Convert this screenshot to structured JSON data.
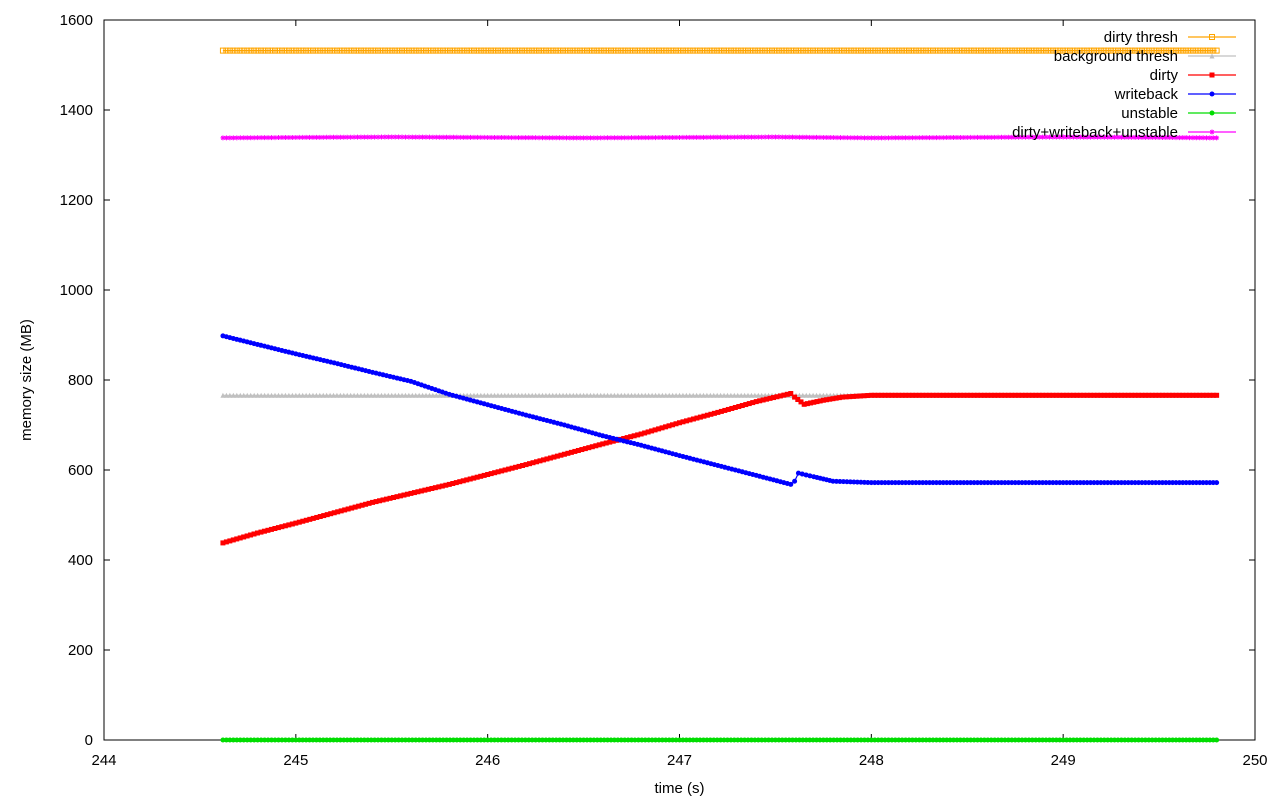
{
  "chart_data": {
    "type": "line",
    "xlabel": "time (s)",
    "ylabel": "memory size (MB)",
    "xlim": [
      244,
      250
    ],
    "ylim": [
      0,
      1600
    ],
    "xticks": [
      244,
      245,
      246,
      247,
      248,
      249,
      250
    ],
    "yticks": [
      0,
      200,
      400,
      600,
      800,
      1000,
      1200,
      1400,
      1600
    ],
    "grid": false,
    "legend_position": "top-right",
    "series": [
      {
        "name": "dirty thresh",
        "color": "#ffa500",
        "marker": "square-open",
        "x": [
          244.62,
          245.0,
          245.5,
          246.0,
          246.5,
          247.0,
          247.5,
          248.0,
          248.5,
          249.0,
          249.5,
          249.8
        ],
        "y": [
          1532,
          1532,
          1532,
          1532,
          1532,
          1532,
          1532,
          1532,
          1532,
          1532,
          1532,
          1532
        ]
      },
      {
        "name": "background thresh",
        "color": "#c0c0c0",
        "marker": "triangle",
        "x": [
          244.62,
          245.0,
          245.5,
          246.0,
          246.5,
          247.0,
          247.5,
          248.0,
          248.5,
          249.0,
          249.5,
          249.8
        ],
        "y": [
          766,
          766,
          766,
          766,
          766,
          766,
          766,
          766,
          766,
          766,
          766,
          766
        ]
      },
      {
        "name": "dirty",
        "color": "#ff0000",
        "marker": "square",
        "x": [
          244.62,
          244.8,
          245.0,
          245.2,
          245.4,
          245.6,
          245.8,
          246.0,
          246.2,
          246.4,
          246.6,
          246.8,
          247.0,
          247.2,
          247.4,
          247.58,
          247.6,
          247.65,
          247.75,
          247.85,
          248.0,
          248.5,
          249.0,
          249.5,
          249.8
        ],
        "y": [
          438,
          460,
          482,
          505,
          528,
          548,
          568,
          590,
          612,
          635,
          658,
          680,
          705,
          728,
          752,
          770,
          762,
          746,
          755,
          762,
          766,
          766,
          766,
          766,
          766
        ]
      },
      {
        "name": "writeback",
        "color": "#0000ff",
        "marker": "circle",
        "x": [
          244.62,
          244.8,
          245.0,
          245.2,
          245.4,
          245.6,
          245.8,
          246.0,
          246.2,
          246.4,
          246.6,
          246.8,
          247.0,
          247.2,
          247.4,
          247.58,
          247.6,
          247.62,
          247.7,
          247.8,
          248.0,
          248.5,
          249.0,
          249.5,
          249.8
        ],
        "y": [
          898,
          879,
          858,
          838,
          817,
          797,
          768,
          745,
          722,
          700,
          676,
          655,
          632,
          610,
          588,
          568,
          575,
          593,
          585,
          575,
          572,
          572,
          572,
          572,
          572
        ]
      },
      {
        "name": "unstable",
        "color": "#00dd00",
        "marker": "circle",
        "x": [
          244.62,
          245.0,
          245.5,
          246.0,
          246.5,
          247.0,
          247.5,
          248.0,
          248.5,
          249.0,
          249.5,
          249.8
        ],
        "y": [
          0,
          0,
          0,
          0,
          0,
          0,
          0,
          0,
          0,
          0,
          0,
          0
        ]
      },
      {
        "name": "dirty+writeback+unstable",
        "color": "#ff00ff",
        "marker": "star",
        "x": [
          244.62,
          245.0,
          245.5,
          246.0,
          246.5,
          247.0,
          247.5,
          248.0,
          248.5,
          249.0,
          249.5,
          249.8
        ],
        "y": [
          1338,
          1339,
          1340,
          1339,
          1338,
          1339,
          1340,
          1338,
          1339,
          1340,
          1339,
          1338
        ]
      }
    ]
  }
}
